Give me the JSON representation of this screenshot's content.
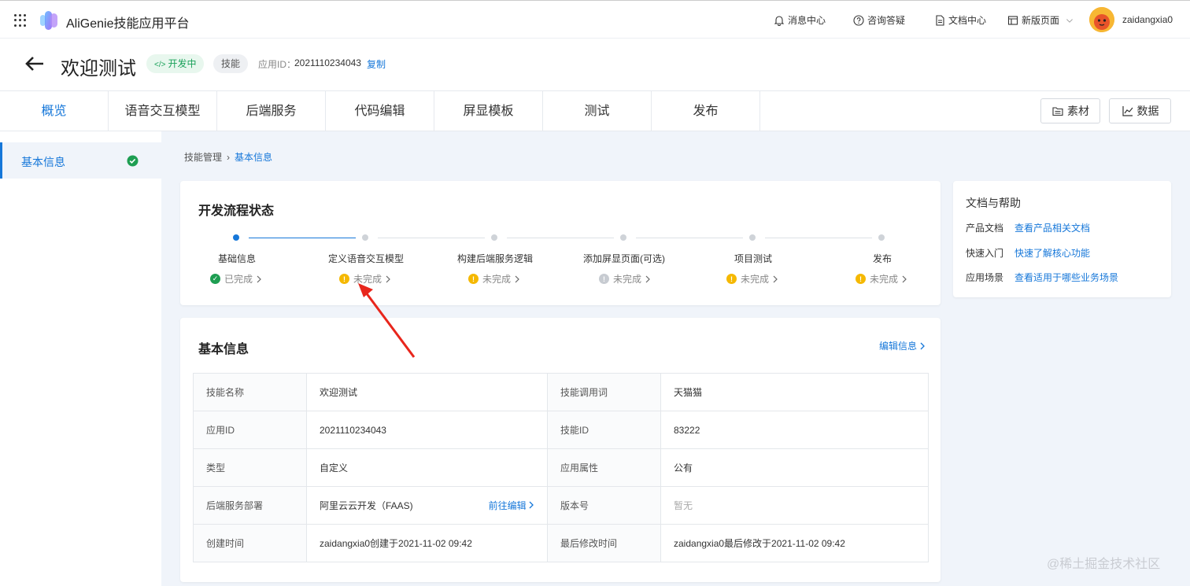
{
  "topbar": {
    "app_title": "AliGenie技能应用平台",
    "nav": {
      "messages": "消息中心",
      "consult": "咨询答疑",
      "docs": "文档中心",
      "new_page": "新版页面"
    },
    "username": "zaidangxia0"
  },
  "header": {
    "title": "欢迎测试",
    "status_badge": "开发中",
    "type_badge": "技能",
    "app_id_label": "应用ID：",
    "app_id_value": "2021110234043",
    "copy_label": "复制"
  },
  "tabs": [
    "概览",
    "语音交互模型",
    "后端服务",
    "代码编辑",
    "屏显模板",
    "测试",
    "发布"
  ],
  "toolbar": {
    "materials": "素材",
    "data": "数据"
  },
  "sidebar": {
    "items": [
      {
        "label": "基本信息"
      }
    ]
  },
  "breadcrumb": {
    "parent": "技能管理",
    "current": "基本信息"
  },
  "flow": {
    "title": "开发流程状态",
    "steps": [
      {
        "name": "基础信息",
        "status": "已完成"
      },
      {
        "name": "定义语音交互模型",
        "status": "未完成"
      },
      {
        "name": "构建后端服务逻辑",
        "status": "未完成"
      },
      {
        "name": "添加屏显页面(可选)",
        "status": "未完成"
      },
      {
        "name": "项目测试",
        "status": "未完成"
      },
      {
        "name": "发布",
        "status": "未完成"
      }
    ]
  },
  "help": {
    "title": "文档与帮助",
    "rows": [
      {
        "label": "产品文档",
        "link": "查看产品相关文档"
      },
      {
        "label": "快速入门",
        "link": "快速了解核心功能"
      },
      {
        "label": "应用场景",
        "link": "查看适用于哪些业务场景"
      }
    ]
  },
  "basic_info": {
    "title": "基本信息",
    "edit_label": "编辑信息",
    "goto_edit": "前往编辑",
    "rows": [
      {
        "k1": "技能名称",
        "v1": "欢迎测试",
        "k2": "技能调用词",
        "v2": "天猫猫"
      },
      {
        "k1": "应用ID",
        "v1": "2021110234043",
        "k2": "技能ID",
        "v2": "83222"
      },
      {
        "k1": "类型",
        "v1": "自定义",
        "k2": "应用属性",
        "v2": "公有"
      },
      {
        "k1": "后端服务部署",
        "v1": "阿里云云开发（FAAS)",
        "k2": "版本号",
        "v2": "暂无"
      },
      {
        "k1": "创建时间",
        "v1": "zaidangxia0创建于2021-11-02 09:42",
        "k2": "最后修改时间",
        "v2": "zaidangxia0最后修改于2021-11-02 09:42"
      }
    ]
  },
  "watermark": "@稀土掘金技术社区",
  "colors": {
    "accent": "#1677d9",
    "success": "#1e9e52",
    "warning": "#f5b800",
    "annotation": "#e8261c"
  }
}
